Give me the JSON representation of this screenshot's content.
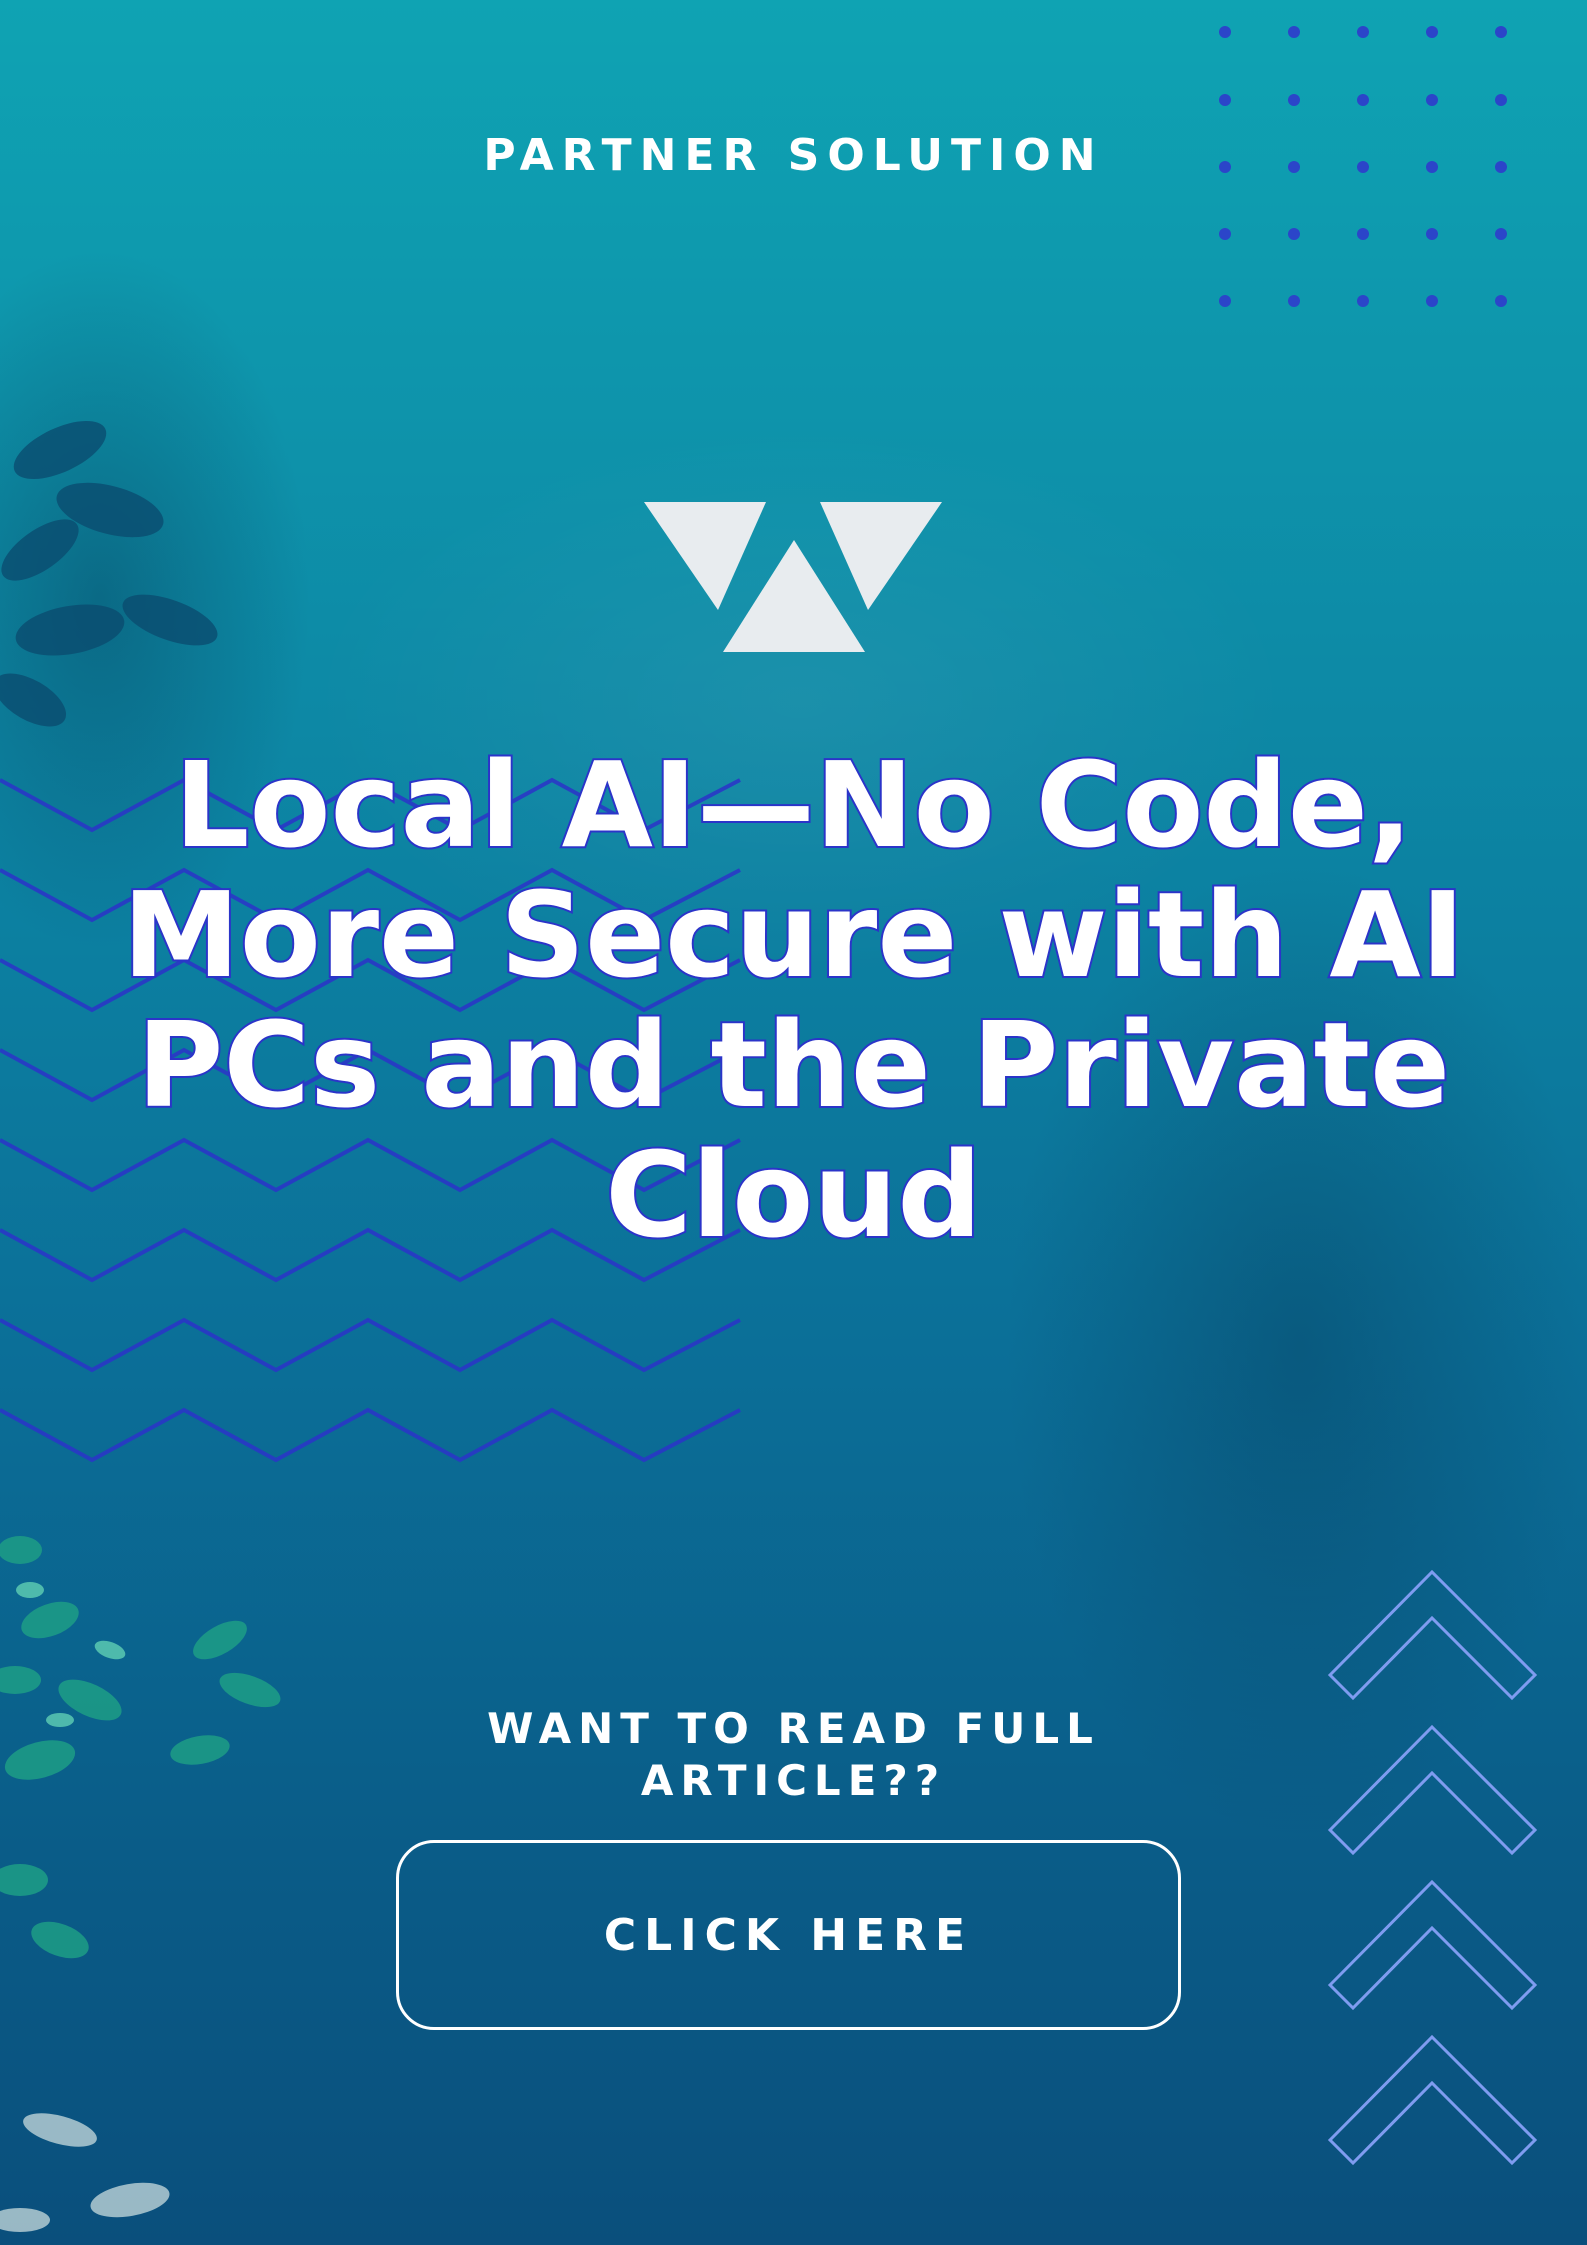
{
  "header": {
    "eyebrow": "PARTNER SOLUTION"
  },
  "logo": {
    "icon": "triangle-logo-icon",
    "color": "#e8ecef"
  },
  "headline": {
    "lines": [
      "Local AI—No Code,",
      "More Secure with AI",
      "PCs and the Private",
      "Cloud"
    ]
  },
  "cta": {
    "prompt_line1": "WANT TO READ FULL",
    "prompt_line2": "ARTICLE??",
    "button_label": "CLICK HERE"
  },
  "decorations": {
    "dot_grid_icon": "dot-grid-icon",
    "zigzag_icon": "zigzag-lines-icon",
    "chevron_icon": "chevron-up-icon",
    "accent_color": "#2b34c9",
    "chevron_color": "#7f9cf0"
  }
}
